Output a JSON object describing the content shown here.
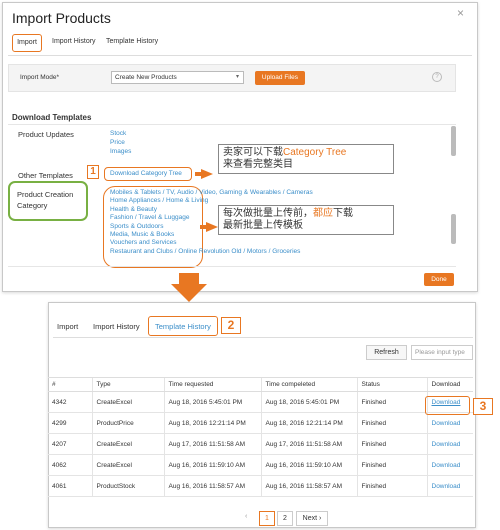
{
  "top": {
    "title": "Import Products",
    "close_icon": "×",
    "tabs": [
      "Import",
      "Import History",
      "Template History"
    ],
    "import_mode_label": "Import Mode*",
    "import_mode_value": "Create New Products",
    "upload_label": "Upload Files",
    "help_icon": "?",
    "download_heading": "Download Templates",
    "product_updates_label": "Product Updates",
    "product_updates_links": [
      "Stock",
      "Price",
      "Images"
    ],
    "other_templates_label": "Other Templates",
    "download_category_tree": "Download Category Tree",
    "product_creation_category": [
      "Product Creation",
      "Category"
    ],
    "categories": [
      "Mobiles & Tablets / TV, Audio / Video, Gaming & Wearables / Cameras",
      "Home Appliances / Home & Living",
      "Health & Beauty",
      "Fashion / Travel & Luggage",
      "Sports & Outdoors",
      "Media, Music & Books",
      "Vouchers and Services",
      "Restaurant and Clubs / Online Revolution Old / Motors / Groceries"
    ],
    "note1_pre": "卖家可以下载",
    "note1_highlight": "Category Tree",
    "note1_line2": "来查看完整类目",
    "note2_pre": "每次做批量上传前，",
    "note2_highlight": "都应",
    "note2_post": "下载",
    "note2_line2": "最新批量上传模板",
    "done_label": "Done",
    "marker1": "1"
  },
  "bottom": {
    "tabs": [
      "Import",
      "Import History",
      "Template History"
    ],
    "marker2": "2",
    "marker3": "3",
    "refresh_label": "Refresh",
    "search_placeholder": "Please input type",
    "columns": [
      "#",
      "Type",
      "Time requested",
      "Time compeleted",
      "Status",
      "Download"
    ],
    "rows": [
      [
        "4342",
        "CreateExcel",
        "Aug 18, 2016 5:45:01 PM",
        "Aug 18, 2016 5:45:01 PM",
        "Finished",
        "Download"
      ],
      [
        "4299",
        "ProductPrice",
        "Aug 18, 2016 12:21:14 PM",
        "Aug 18, 2016 12:21:14 PM",
        "Finished",
        "Download"
      ],
      [
        "4207",
        "CreateExcel",
        "Aug 17, 2016 11:51:58 AM",
        "Aug 17, 2016 11:51:58 AM",
        "Finished",
        "Download"
      ],
      [
        "4062",
        "CreateExcel",
        "Aug 16, 2016 11:59:10 AM",
        "Aug 16, 2016 11:59:10 AM",
        "Finished",
        "Download"
      ],
      [
        "4061",
        "ProductStock",
        "Aug 16, 2016 11:58:57 AM",
        "Aug 16, 2016 11:58:57 AM",
        "Finished",
        "Download"
      ]
    ],
    "pager": {
      "prev": "‹",
      "pages": [
        "1",
        "2"
      ],
      "next": "Next ›"
    }
  },
  "colors": {
    "accent": "#e87722",
    "link": "#3b8ec9",
    "highlight_green": "#78b043"
  }
}
